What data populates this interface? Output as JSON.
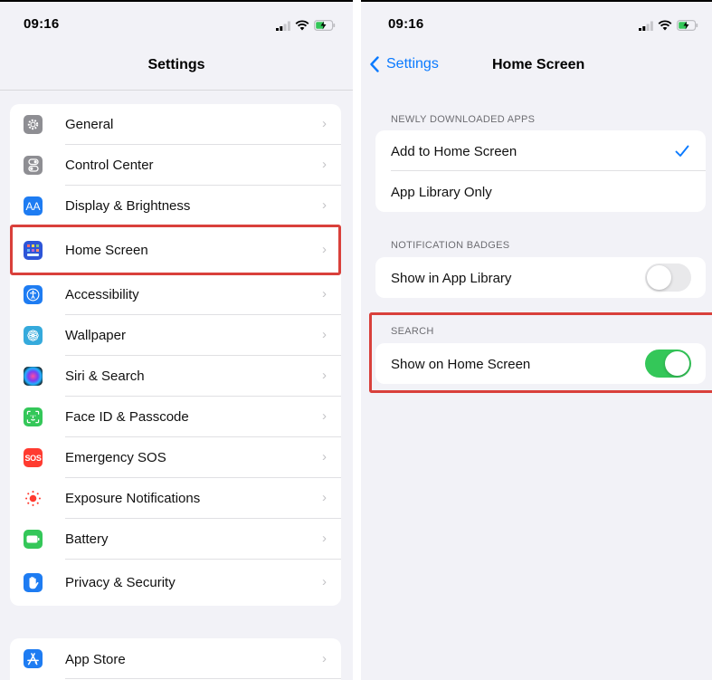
{
  "colors": {
    "accent_blue": "#0a7aff",
    "toggle_on": "#34c759",
    "highlight_red": "#d9403b",
    "background": "#f2f2f7"
  },
  "left": {
    "status_time": "09:16",
    "title": "Settings",
    "groups": [
      [
        {
          "label": "General",
          "icon": "gear-icon",
          "color": "#8e8e93"
        },
        {
          "label": "Control Center",
          "icon": "toggles-icon",
          "color": "#8e8e93"
        },
        {
          "label": "Display & Brightness",
          "icon": "text-size-icon",
          "color": "#1e7cf2"
        },
        {
          "label": "Home Screen",
          "icon": "app-grid-icon",
          "color": "#2d55d8"
        },
        {
          "label": "Accessibility",
          "icon": "accessibility-icon",
          "color": "#1e7cf2"
        },
        {
          "label": "Wallpaper",
          "icon": "flower-icon",
          "color": "#35aadc"
        },
        {
          "label": "Siri & Search",
          "icon": "siri-icon",
          "color": "#1a1a2e"
        },
        {
          "label": "Face ID & Passcode",
          "icon": "face-id-icon",
          "color": "#34c759"
        },
        {
          "label": "Emergency SOS",
          "icon": "sos-icon",
          "color": "#ff3b30",
          "badge": "SOS"
        },
        {
          "label": "Exposure Notifications",
          "icon": "exposure-icon",
          "color": "#ffffff"
        },
        {
          "label": "Battery",
          "icon": "battery-icon",
          "color": "#34c759"
        },
        {
          "label": "Privacy & Security",
          "icon": "hand-icon",
          "color": "#1e7cf2"
        }
      ],
      [
        {
          "label": "App Store",
          "icon": "app-store-icon",
          "color": "#1e7cf2"
        }
      ]
    ]
  },
  "right": {
    "status_time": "09:16",
    "back_label": "Settings",
    "title": "Home Screen",
    "sections": [
      {
        "header": "NEWLY DOWNLOADED APPS",
        "rows": [
          {
            "label": "Add to Home Screen",
            "checked": true
          },
          {
            "label": "App Library Only",
            "checked": false
          }
        ]
      },
      {
        "header": "NOTIFICATION BADGES",
        "rows": [
          {
            "label": "Show in App Library",
            "toggle": false
          }
        ]
      },
      {
        "header": "SEARCH",
        "rows": [
          {
            "label": "Show on Home Screen",
            "toggle": true
          }
        ]
      }
    ]
  }
}
